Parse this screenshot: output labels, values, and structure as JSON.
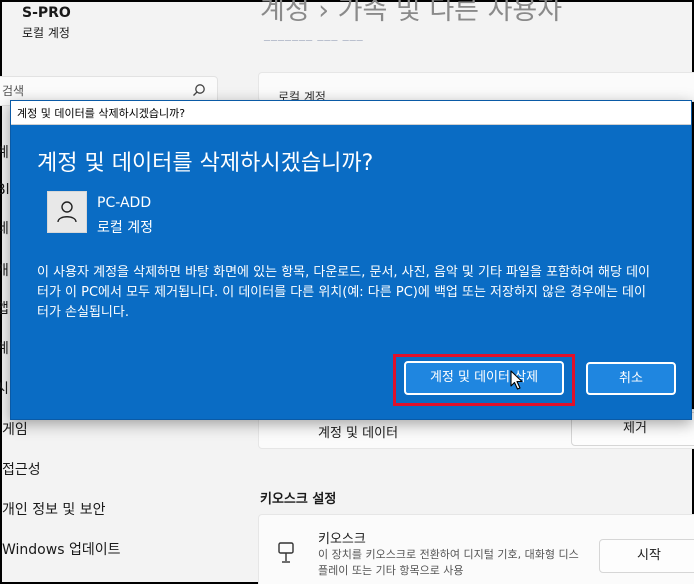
{
  "user": {
    "name": "S-PRO",
    "type": "로컬 계정"
  },
  "page": {
    "heading": "계정 › 가족 및 다른 사용자",
    "heading_tail": "─────── ─── ───"
  },
  "search": {
    "text": "검색"
  },
  "local_account": {
    "label": "로컬 계정"
  },
  "sidebar": {
    "items": [
      {
        "label": "게임"
      },
      {
        "label": "접근성"
      },
      {
        "label": "개인 정보 및 보안"
      },
      {
        "label": "Windows 업데이트"
      }
    ],
    "fragments": [
      "계",
      "Bl",
      "네",
      "개",
      "앱",
      "계",
      "시"
    ]
  },
  "account_data": {
    "label": "계정 및 데이터",
    "remove_label": "제거"
  },
  "kiosk": {
    "section_title": "키오스크 설정",
    "name": "키오스크",
    "description": "이 장치를 키오스크로 전환하여 디지털 기호, 대화형 디스플레이 또는 기타 항목으로 사용",
    "start_label": "시작"
  },
  "dialog": {
    "titlebar": "계정 및 데이터를 삭제하시겠습니까?",
    "heading": "계정 및 데이터를 삭제하시겠습니까?",
    "account_name": "PC-ADD",
    "account_type": "로컬 계정",
    "message": "이 사용자 계정을 삭제하면 바탕 화면에 있는 항목, 다운로드, 문서, 사진, 음악 및 기타 파일을 포함하여 해당 데이터가 이 PC에서 모두 제거됩니다. 이 데이터를 다른 위치(예: 다른 PC)에 백업 또는 저장하지 않은 경우에는 데이터가 손실됩니다.",
    "confirm_label": "계정 및 데이터 삭제",
    "cancel_label": "취소"
  },
  "colors": {
    "dialog_bg": "#0a6cc4",
    "highlight": "#e0102a",
    "button": "#1f86e0"
  }
}
